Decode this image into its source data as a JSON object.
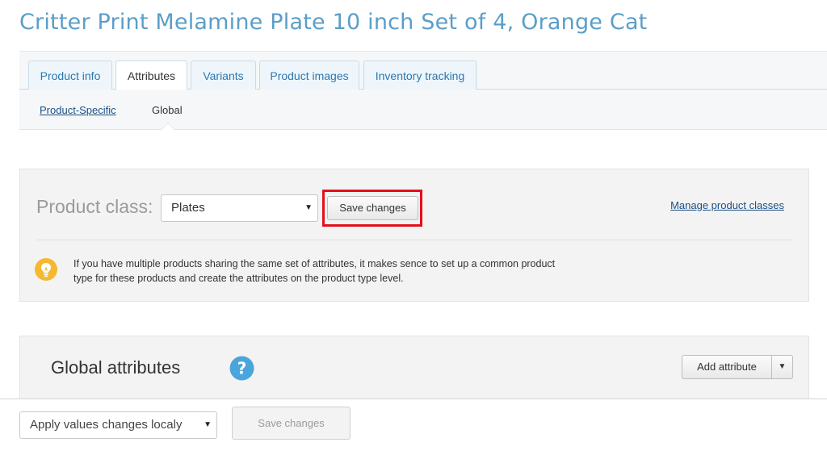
{
  "page": {
    "title": "Critter Print Melamine Plate 10 inch Set of 4, Orange Cat"
  },
  "tabs": [
    {
      "label": "Product info",
      "active": false
    },
    {
      "label": "Attributes",
      "active": true
    },
    {
      "label": "Variants",
      "active": false
    },
    {
      "label": "Product images",
      "active": false
    },
    {
      "label": "Inventory tracking",
      "active": false
    }
  ],
  "subtabs": [
    {
      "label": "Product-Specific",
      "active": false
    },
    {
      "label": "Global",
      "active": true
    }
  ],
  "product_class": {
    "label": "Product class:",
    "selected": "Plates",
    "save_label": "Save changes",
    "manage_link": "Manage product classes",
    "hint_text": "If you have multiple products sharing the same set of attributes, it makes sence to set up a common product type for these products and create the attributes on the product type level.",
    "highlight_color": "#e3101b"
  },
  "global_attributes": {
    "title": "Global attributes",
    "add_label": "Add attribute",
    "help_icon": "question-circle-icon"
  },
  "bottom_bar": {
    "apply_selected": "Apply values changes localy",
    "save_label": "Save changes",
    "save_enabled": false
  },
  "colors": {
    "title": "#5a9ec9",
    "link": "#1c4f85",
    "hint_icon": "#f5b82e",
    "help_icon": "#4aa5dd"
  }
}
